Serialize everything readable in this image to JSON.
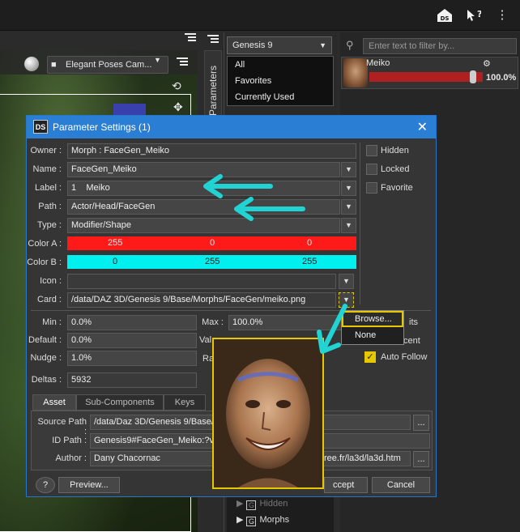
{
  "topbar": {
    "ds_icon": "DS",
    "help_icon": "?",
    "menu_icon": "⋮"
  },
  "viewport": {
    "camera_label": "Elegant Poses Cam..."
  },
  "side_tab": {
    "label": "Parameters"
  },
  "figure_selector": {
    "value": "Genesis 9",
    "menu_items": [
      "All",
      "Favorites",
      "Currently Used"
    ],
    "behind_item": "Genesis 9"
  },
  "right_panel": {
    "filter_placeholder": "Enter text to filter by...",
    "slider_name": "Meiko",
    "slider_value": "100.0%"
  },
  "dialog": {
    "title": "Parameter Settings (1)",
    "owner_label": "Owner :",
    "owner_value": "Morph : FaceGen_Meiko",
    "name_label": "Name :",
    "name_value": "FaceGen_Meiko",
    "label_label": "Label :",
    "label_index": "1",
    "label_value": "Meiko",
    "path_label": "Path :",
    "path_value": "Actor/Head/FaceGen",
    "type_label": "Type :",
    "type_value": "Modifier/Shape",
    "color_a_label": "Color A :",
    "color_a_values": [
      "255",
      "0",
      "0"
    ],
    "color_a": "#ff0000",
    "color_b_label": "Color B :",
    "color_b_values": [
      "0",
      "255",
      "255"
    ],
    "color_b": "#00ffff",
    "icon_label": "Icon :",
    "icon_value": "",
    "card_label": "Card :",
    "card_value": "/data/DAZ 3D/Genesis 9/Base/Morphs/FaceGen/meiko.png",
    "hidden_label": "Hidden",
    "locked_label": "Locked",
    "favorite_label": "Favorite",
    "min_label": "Min :",
    "min_value": "0.0%",
    "max_label": "Max :",
    "max_value": "100.0%",
    "default_label": "Default :",
    "default_value": "0.0%",
    "value_label": "Val",
    "nudge_label": "Nudge :",
    "nudge_value": "1.0%",
    "range_label": "Ra",
    "limits_label": "its",
    "percent_label": "cent",
    "auto_follow_label": "Auto Follow",
    "deltas_label": "Deltas :",
    "deltas_value": "5932",
    "tabs": [
      "Asset",
      "Sub-Components",
      "Keys"
    ],
    "source_path_label": "Source Path :",
    "source_path_value": "/data/Daz 3D/Genesis 9/Base/I",
    "id_path_label": "ID Path :",
    "id_path_value": "Genesis9#FaceGen_Meiko:?va",
    "author_label": "Author :",
    "author_value": "Dany Chacornac",
    "author_url": "ree.fr/la3d/la3d.htm",
    "more_button": "...",
    "help_button": "?",
    "preview_button": "Preview...",
    "accept_button": "ccept",
    "cancel_button": "Cancel"
  },
  "card_popup": {
    "items": [
      "Browse...",
      "None"
    ]
  },
  "tree": {
    "items": [
      "Hidden",
      "Morphs"
    ]
  },
  "colors": {
    "accent": "#2a7fd4",
    "highlight": "#e7c800",
    "annotation_arrow": "#22d3d3"
  }
}
